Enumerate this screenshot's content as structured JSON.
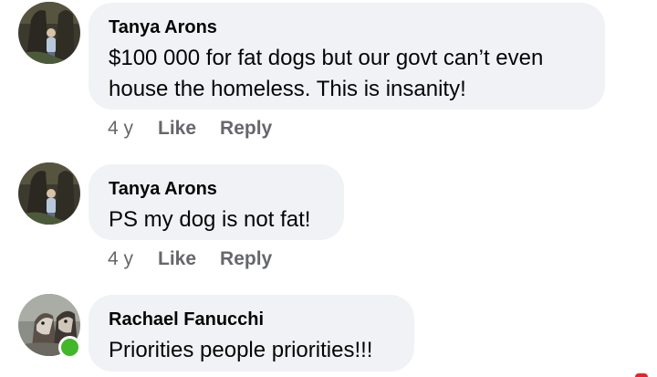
{
  "comments": [
    {
      "author": "Tanya Arons",
      "text_lines": [
        "$100 000 for fat dogs but our govt can’t even",
        "house the homeless.  This is insanity!"
      ],
      "time": "4 y",
      "like_label": "Like",
      "reply_label": "Reply",
      "avatar_icon": "profile-photo-person-tree",
      "online": false
    },
    {
      "author": "Tanya Arons",
      "text_lines": [
        "PS my dog is not fat!"
      ],
      "time": "4 y",
      "like_label": "Like",
      "reply_label": "Reply",
      "avatar_icon": "profile-photo-person-tree",
      "online": false
    },
    {
      "author": "Rachael Fanucchi",
      "text_lines": [
        "Priorities people priorities!!!"
      ],
      "avatar_icon": "profile-photo-dogs",
      "online": true
    }
  ],
  "colors": {
    "bubble_bg": "#f0f2f5",
    "meta_text": "#65676b",
    "online_dot": "#42b72a"
  }
}
